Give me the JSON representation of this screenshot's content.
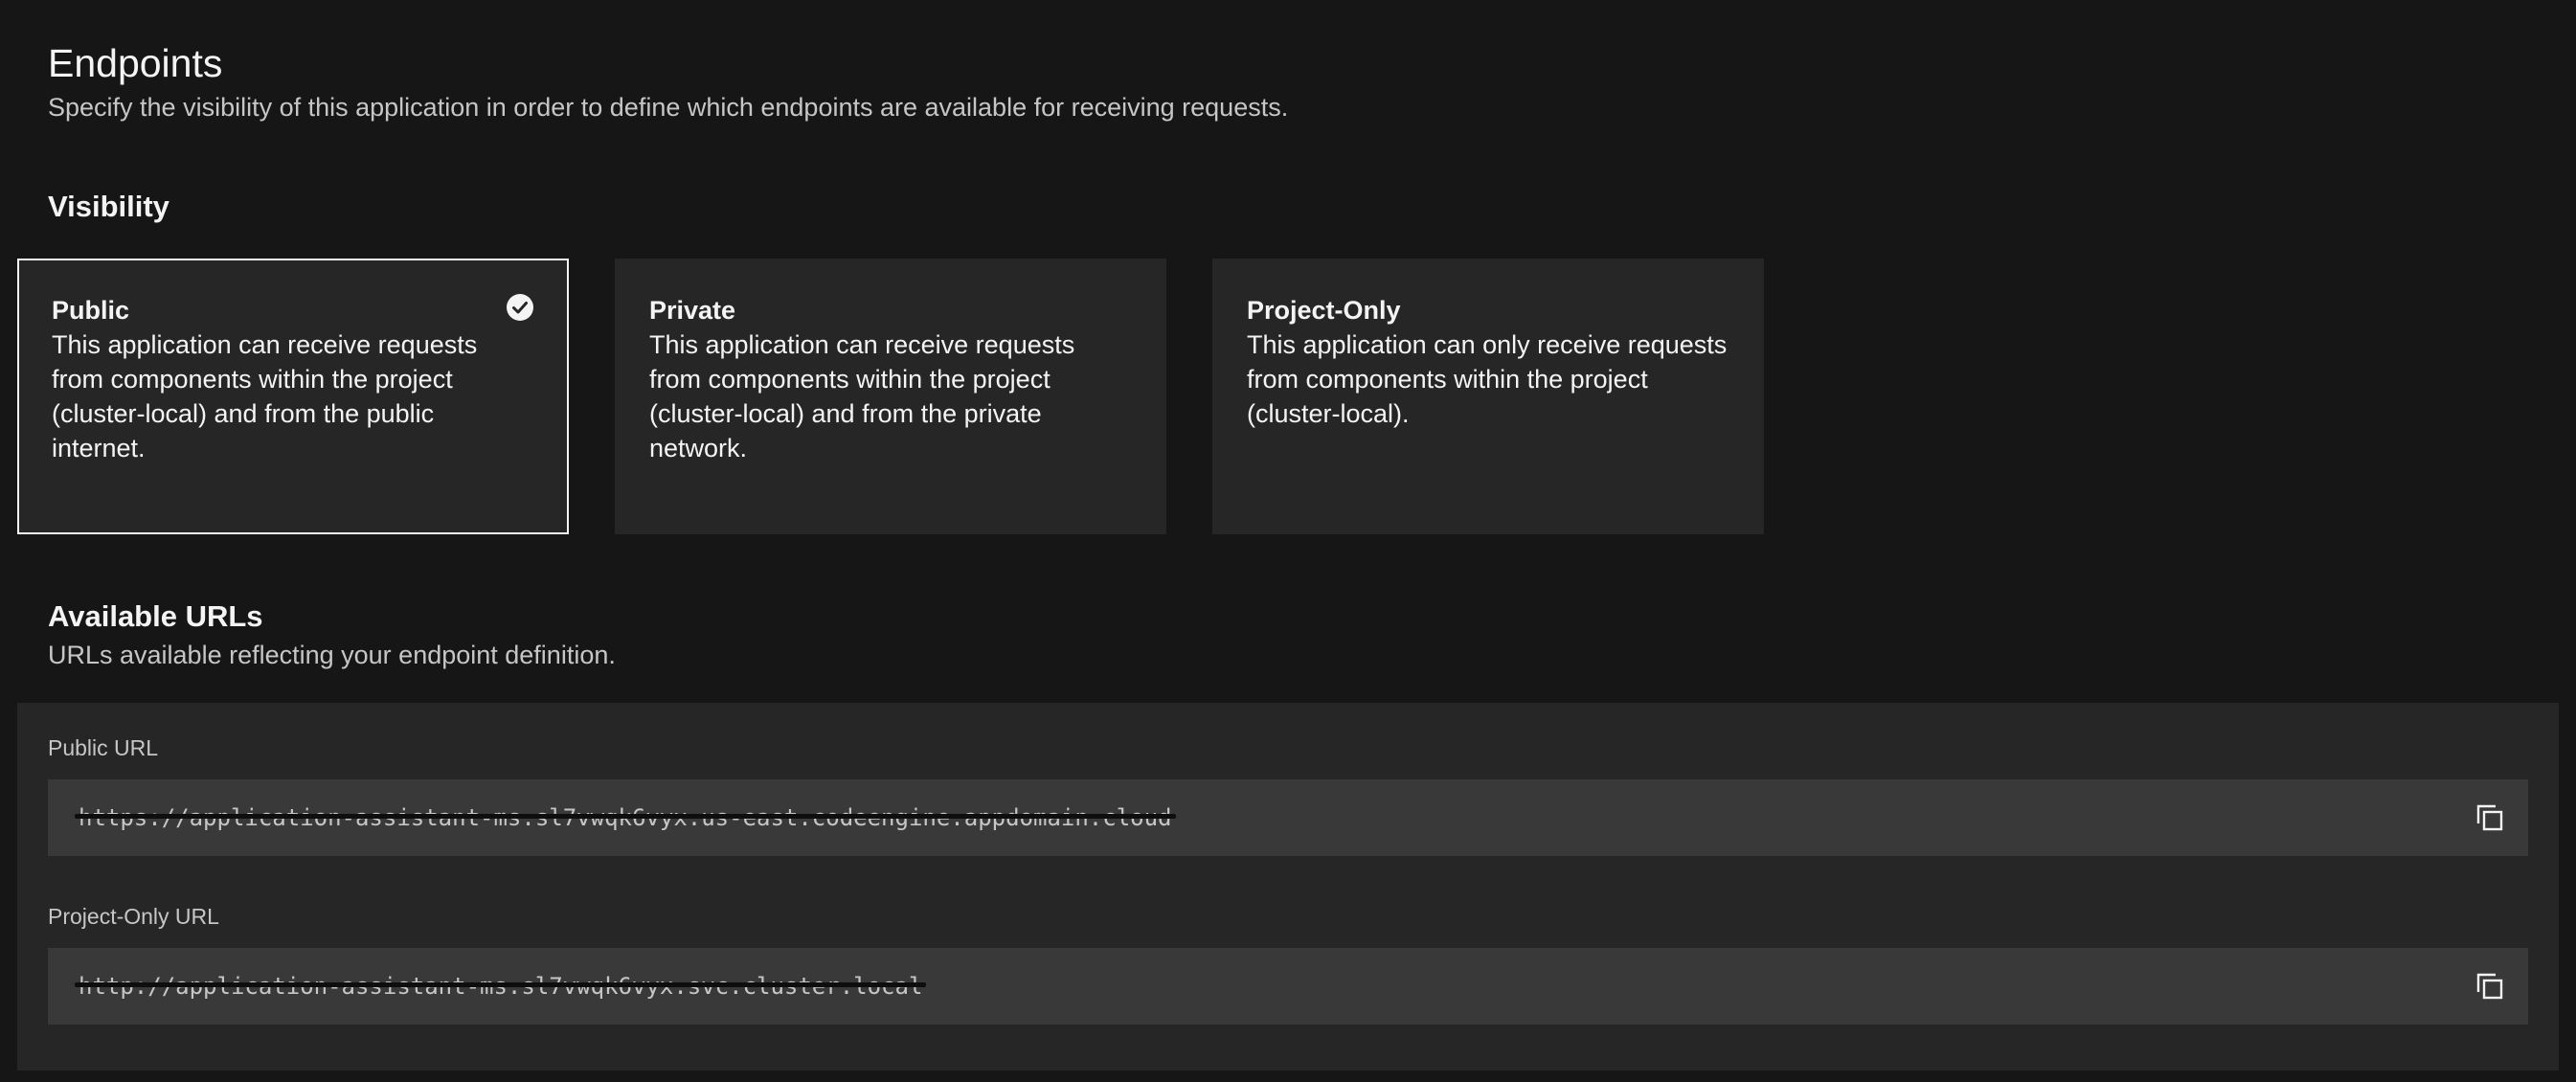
{
  "header": {
    "title": "Endpoints",
    "description": "Specify the visibility of this application in order to define which endpoints are available for receiving requests."
  },
  "visibility": {
    "heading": "Visibility",
    "selected": "Public",
    "options": [
      {
        "title": "Public",
        "description": "This application can receive requests from components within the project (cluster-local) and from the public internet."
      },
      {
        "title": "Private",
        "description": "This application can receive requests from components within the project (cluster-local) and from the private network."
      },
      {
        "title": "Project-Only",
        "description": "This application can only receive requests from components within the project (cluster-local)."
      }
    ]
  },
  "available_urls": {
    "heading": "Available URLs",
    "description": "URLs available reflecting your endpoint definition.",
    "public": {
      "label": "Public URL",
      "value": "https://application-assistant-ms.sl7vwqk6vyx.us-east.codeengine.appdomain.cloud"
    },
    "project_only": {
      "label": "Project-Only URL",
      "value": "http://application-assistant-ms.sl7vwqk6vyx.svc.cluster.local"
    }
  },
  "icons": {
    "selected_check": "checkmark-filled-icon",
    "copy": "copy-icon"
  },
  "colors": {
    "background": "#161616",
    "tile": "#262626",
    "field": "#393939",
    "text_primary": "#f4f4f4",
    "text_secondary": "#c6c6c6"
  }
}
